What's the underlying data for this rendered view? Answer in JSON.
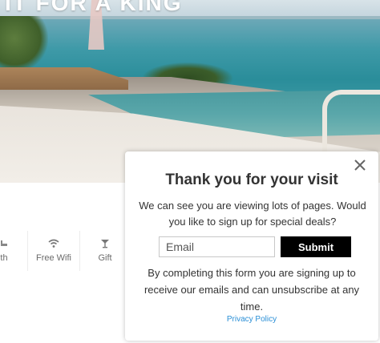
{
  "hero": {
    "title": "IT FOR A KING"
  },
  "amenities": [
    {
      "label": "th",
      "icon": "bath-icon"
    },
    {
      "label": "Free Wifi",
      "icon": "wifi-icon"
    },
    {
      "label": "Gift",
      "icon": "gift-icon"
    }
  ],
  "popup": {
    "close_icon": "close-icon",
    "title": "Thank you for your visit",
    "message": "We can see you are viewing lots of pages. Would you like to sign up for special deals?",
    "email_placeholder": "Email",
    "email_value": "",
    "submit_label": "Submit",
    "note": "By completing this form you are signing up to receive our emails and can unsubscribe at any time.",
    "privacy_label": "Privacy Policy",
    "colors": {
      "button_bg": "#000000",
      "link": "#2a8fd6",
      "title": "#333333"
    }
  }
}
